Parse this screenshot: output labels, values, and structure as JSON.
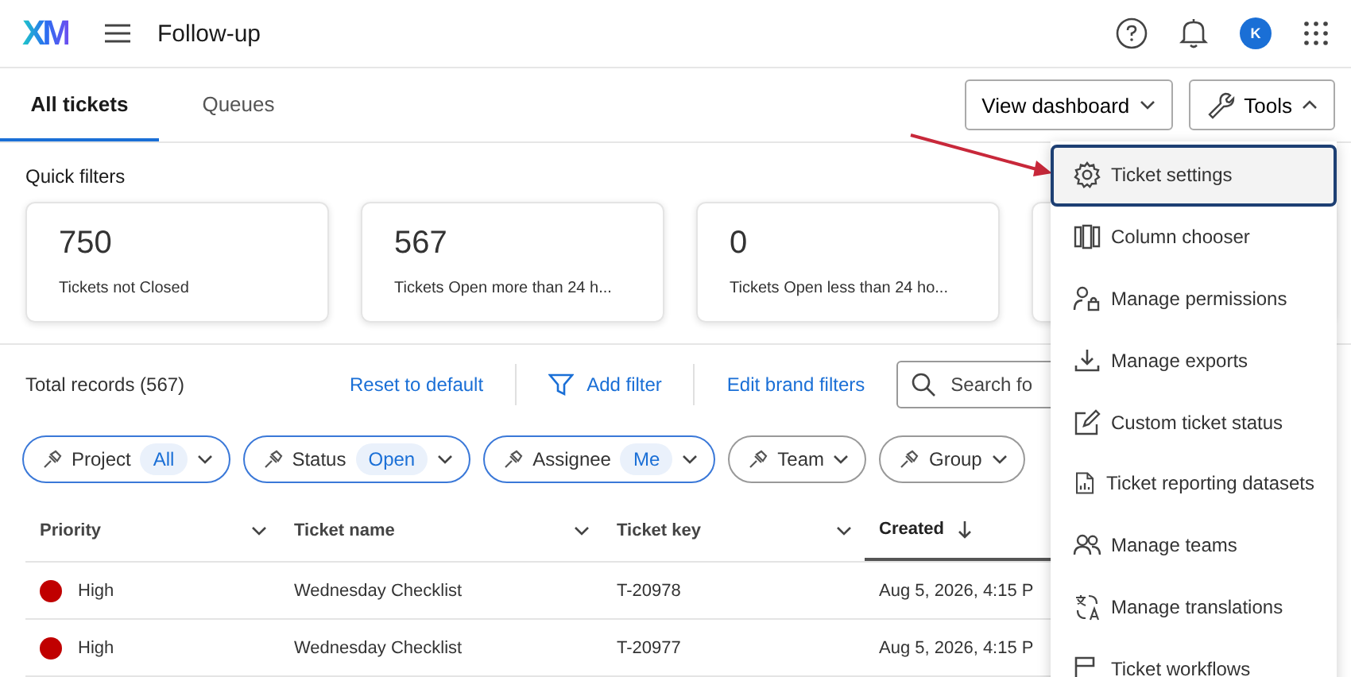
{
  "header": {
    "logo": "XM",
    "title": "Follow-up",
    "avatar": "K"
  },
  "tabs": [
    {
      "label": "All tickets",
      "selected": true
    },
    {
      "label": "Queues",
      "selected": false
    }
  ],
  "actions": [
    {
      "label": "View dashboard",
      "expanded": false
    },
    {
      "label": "Tools",
      "expanded": true
    }
  ],
  "quick_filters": {
    "title": "Quick filters",
    "cards": [
      {
        "count": "750",
        "label": "Tickets not Closed"
      },
      {
        "count": "567",
        "label": "Tickets Open more than 24 h..."
      },
      {
        "count": "0",
        "label": "Tickets Open less than 24 ho..."
      }
    ]
  },
  "toolbar": {
    "total": "Total records (567)",
    "reset": "Reset to default",
    "add_filter": "Add filter",
    "edit_brand": "Edit brand filters",
    "search_placeholder": "Search fo"
  },
  "filter_chips": [
    {
      "label": "Project",
      "value": "All"
    },
    {
      "label": "Status",
      "value": "Open"
    },
    {
      "label": "Assignee",
      "value": "Me"
    },
    {
      "label": "Team"
    },
    {
      "label": "Group"
    }
  ],
  "table": {
    "columns": [
      {
        "label": "Priority",
        "sorted": false
      },
      {
        "label": "Ticket name",
        "sorted": false
      },
      {
        "label": "Ticket key",
        "sorted": false
      },
      {
        "label": "Created",
        "sorted": true
      }
    ],
    "rows": [
      {
        "priority": "High",
        "color": "#c00000",
        "name": "Wednesday Checklist",
        "key": "T-20978",
        "created": "Aug 5, 2026, 4:15 P"
      },
      {
        "priority": "High",
        "color": "#c00000",
        "name": "Wednesday Checklist",
        "key": "T-20977",
        "created": "Aug 5, 2026, 4:15 P"
      }
    ]
  },
  "tools_menu": [
    {
      "label": "Ticket settings",
      "selected": true
    },
    {
      "label": "Column chooser",
      "selected": false
    },
    {
      "label": "Manage permissions",
      "selected": false
    },
    {
      "label": "Manage exports",
      "selected": false
    },
    {
      "label": "Custom ticket status",
      "selected": false
    },
    {
      "label": "Ticket reporting datasets",
      "selected": false
    },
    {
      "label": "Manage teams",
      "selected": false
    },
    {
      "label": "Manage translations",
      "selected": false
    },
    {
      "label": "Ticket workflows",
      "selected": false
    }
  ]
}
